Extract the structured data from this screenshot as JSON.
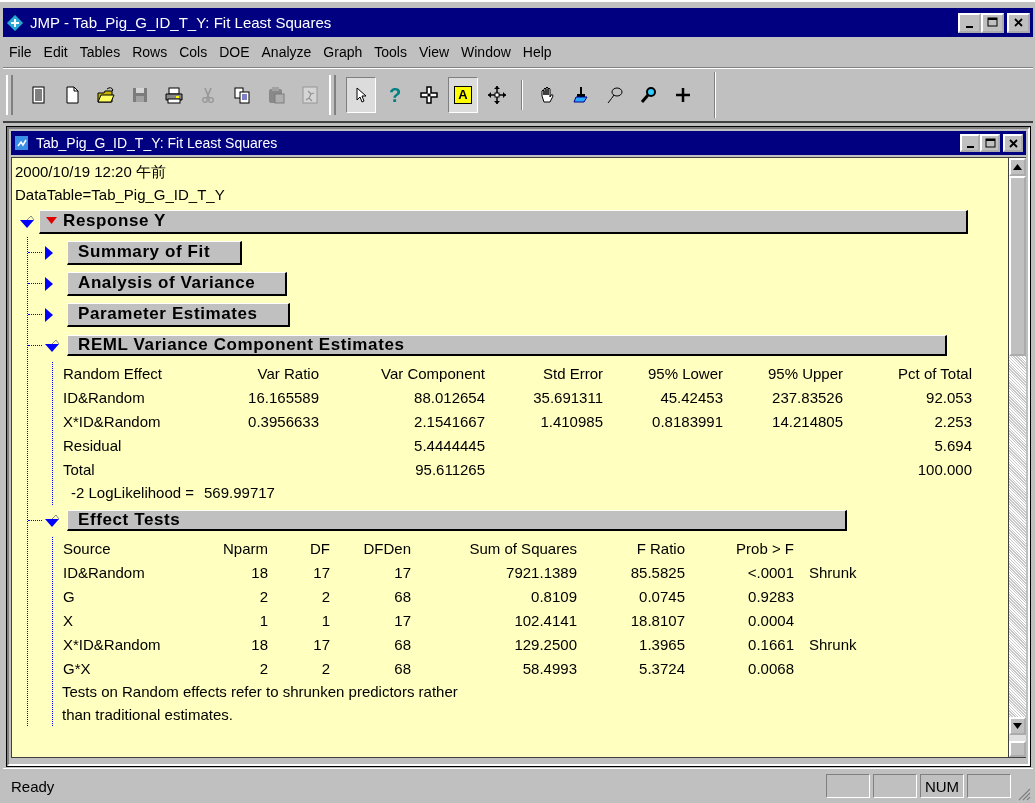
{
  "window": {
    "title": "JMP - Tab_Pig_G_ID_T_Y: Fit Least Squares"
  },
  "menu": [
    {
      "label": "File"
    },
    {
      "label": "Edit"
    },
    {
      "label": "Tables"
    },
    {
      "label": "Rows"
    },
    {
      "label": "Cols"
    },
    {
      "label": "DOE"
    },
    {
      "label": "Analyze"
    },
    {
      "label": "Graph"
    },
    {
      "label": "Tools"
    },
    {
      "label": "View"
    },
    {
      "label": "Window"
    },
    {
      "label": "Help"
    }
  ],
  "toolbar": [
    {
      "kind": "grip"
    },
    {
      "kind": "report",
      "disabled": false,
      "pressed": false
    },
    {
      "kind": "new",
      "disabled": false,
      "pressed": false
    },
    {
      "kind": "open",
      "disabled": false,
      "pressed": false
    },
    {
      "kind": "save",
      "disabled": true,
      "pressed": false
    },
    {
      "kind": "print",
      "disabled": false,
      "pressed": false
    },
    {
      "kind": "cut",
      "disabled": true,
      "pressed": false
    },
    {
      "kind": "copy",
      "disabled": false,
      "pressed": false
    },
    {
      "kind": "paste",
      "disabled": true,
      "pressed": false
    },
    {
      "kind": "journal",
      "disabled": true,
      "pressed": false
    },
    {
      "kind": "grip"
    },
    {
      "kind": "arrow",
      "disabled": false,
      "pressed": true
    },
    {
      "kind": "help",
      "glyph": "?",
      "disabled": false,
      "pressed": false
    },
    {
      "kind": "crosshair",
      "disabled": false,
      "pressed": false
    },
    {
      "kind": "annotate",
      "glyph": "A",
      "disabled": false,
      "pressed": true
    },
    {
      "kind": "move",
      "disabled": false,
      "pressed": false
    },
    {
      "kind": "separator"
    },
    {
      "kind": "hand",
      "disabled": false,
      "pressed": false
    },
    {
      "kind": "brush",
      "disabled": false,
      "pressed": false
    },
    {
      "kind": "lasso",
      "disabled": false,
      "pressed": false
    },
    {
      "kind": "magnifier",
      "disabled": false,
      "pressed": false
    },
    {
      "kind": "plus",
      "disabled": false,
      "pressed": false
    }
  ],
  "document": {
    "title": "Tab_Pig_G_ID_T_Y: Fit Least Squares",
    "lines": [
      "2000/10/19 12:20 午前",
      "DataTable=Tab_Pig_G_ID_T_Y"
    ],
    "report": {
      "title": "Response Y",
      "expanded": true,
      "children": [
        {
          "title": "Summary of Fit",
          "expanded": false
        },
        {
          "title": "Analysis of Variance",
          "expanded": false
        },
        {
          "title": "Parameter Estimates",
          "expanded": false
        },
        {
          "title": "REML Variance Component Estimates",
          "expanded": true,
          "table": {
            "kind": "reml",
            "columns": [
              "Random Effect",
              "Var Ratio",
              "Var Component",
              "Std Error",
              "95% Lower",
              "95% Upper",
              "Pct of Total"
            ],
            "rows": [
              [
                "ID&Random",
                "16.165589",
                "88.012654",
                "35.691311",
                "45.42453",
                "237.83526",
                "92.053"
              ],
              [
                "X*ID&Random",
                "0.3956633",
                "2.1541667",
                "1.410985",
                "0.8183991",
                "14.214805",
                "2.253"
              ],
              [
                "Residual",
                null,
                "5.4444445",
                null,
                null,
                null,
                "5.694"
              ],
              [
                "Total",
                null,
                "95.611265",
                null,
                null,
                null,
                "100.000"
              ]
            ]
          },
          "stat": {
            "label": "-2 LogLikelihood =",
            "value": "569.99717"
          }
        },
        {
          "title": "Effect Tests",
          "expanded": true,
          "table": {
            "kind": "effects",
            "columns": [
              "Source",
              "Nparm",
              "DF",
              "DFDen",
              "Sum of Squares",
              "F Ratio",
              "Prob > F"
            ],
            "rows": [
              [
                "ID&Random",
                "18",
                "17",
                "17",
                "7921.1389",
                "85.5825",
                "<.0001",
                "Shrunk"
              ],
              [
                "G",
                "2",
                "2",
                "68",
                "0.8109",
                "0.0745",
                "0.9283",
                null
              ],
              [
                "X",
                "1",
                "1",
                "17",
                "102.4141",
                "18.8107",
                "0.0004",
                null
              ],
              [
                "X*ID&Random",
                "18",
                "17",
                "68",
                "129.2500",
                "1.3965",
                "0.1661",
                "Shrunk"
              ],
              [
                "G*X",
                "2",
                "2",
                "68",
                "58.4993",
                "5.3724",
                "0.0068",
                null
              ]
            ]
          },
          "note": [
            "Tests on Random effects refer to shrunken predictors rather",
            "than traditional estimates."
          ]
        }
      ]
    }
  },
  "status_bar": {
    "text": "Ready",
    "panes": [
      {
        "kind": "blank"
      },
      {
        "kind": "blank"
      },
      {
        "kind": "text",
        "text": "NUM"
      },
      {
        "kind": "blank"
      }
    ]
  }
}
